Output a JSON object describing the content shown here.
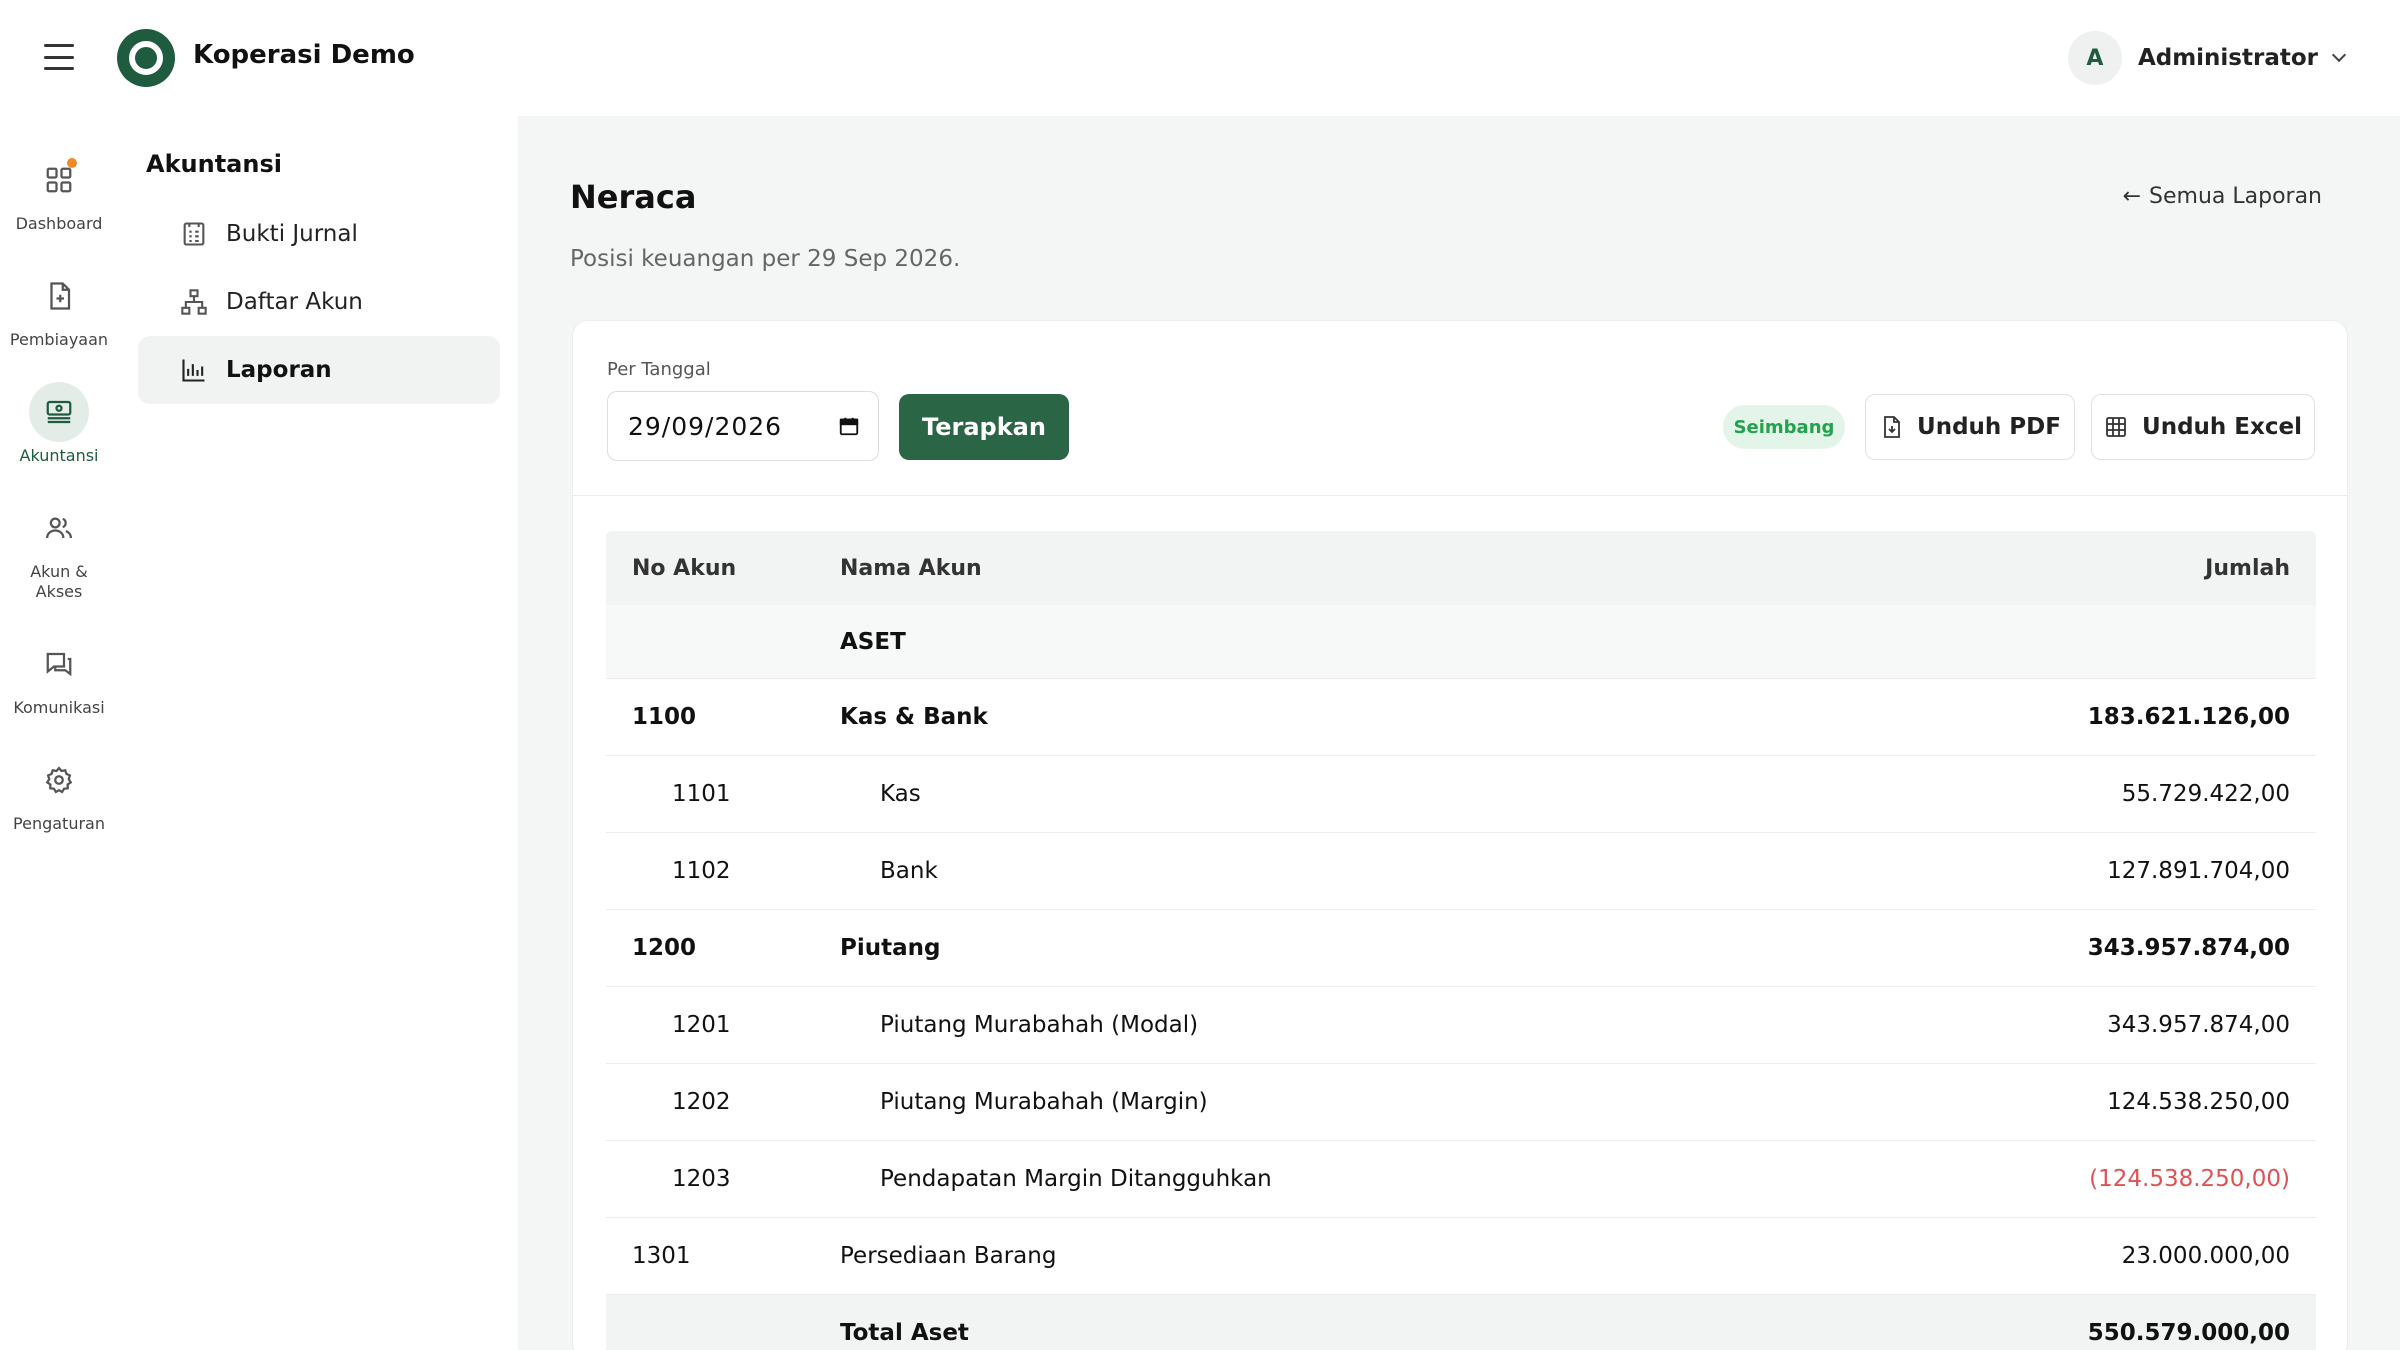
{
  "header": {
    "brand_name": "Koperasi Demo",
    "user_initial": "A",
    "user_name": "Administrator"
  },
  "rail": {
    "items": [
      {
        "label": "Dashboard",
        "icon": "grid-icon"
      },
      {
        "label": "Pembiayaan",
        "icon": "document-plus-icon"
      },
      {
        "label": "Akuntansi",
        "icon": "cash-register-icon"
      },
      {
        "label": "Akun & Akses",
        "icon": "users-icon"
      },
      {
        "label": "Komunikasi",
        "icon": "chat-icon"
      },
      {
        "label": "Pengaturan",
        "icon": "gear-icon"
      }
    ]
  },
  "subnav": {
    "title": "Akuntansi",
    "items": [
      {
        "label": "Bukti Jurnal",
        "icon": "journal-icon"
      },
      {
        "label": "Daftar Akun",
        "icon": "hierarchy-icon"
      },
      {
        "label": "Laporan",
        "icon": "bar-chart-icon"
      }
    ]
  },
  "page": {
    "title": "Neraca",
    "subtitle": "Posisi keuangan per 29 Sep 2026.",
    "back_link": "Semua Laporan"
  },
  "filter": {
    "label": "Per Tanggal",
    "date_value": "29/09/2026",
    "apply_label": "Terapkan",
    "status_badge": "Seimbang",
    "pdf_label": "Unduh PDF",
    "excel_label": "Unduh Excel"
  },
  "table": {
    "headers": {
      "no": "No Akun",
      "name": "Nama Akun",
      "amount": "Jumlah"
    },
    "section": "ASET",
    "rows": [
      {
        "no": "1100",
        "name": "Kas & Bank",
        "amount": "183.621.126,00"
      },
      {
        "no": "1101",
        "name": "Kas",
        "amount": "55.729.422,00"
      },
      {
        "no": "1102",
        "name": "Bank",
        "amount": "127.891.704,00"
      },
      {
        "no": "1200",
        "name": "Piutang",
        "amount": "343.957.874,00"
      },
      {
        "no": "1201",
        "name": "Piutang Murabahah (Modal)",
        "amount": "343.957.874,00"
      },
      {
        "no": "1202",
        "name": "Piutang Murabahah (Margin)",
        "amount": "124.538.250,00"
      },
      {
        "no": "1203",
        "name": "Pendapatan Margin Ditangguhkan",
        "amount": "(124.538.250,00)"
      },
      {
        "no": "1301",
        "name": "Persediaan Barang",
        "amount": "23.000.000,00"
      }
    ],
    "total": {
      "name": "Total Aset",
      "amount": "550.579.000,00"
    }
  },
  "colors": {
    "brand": "#1f5c3f",
    "primary_button": "#2a6645",
    "badge_text": "#23a24d",
    "negative": "#e05252",
    "notification": "#f08a24"
  }
}
